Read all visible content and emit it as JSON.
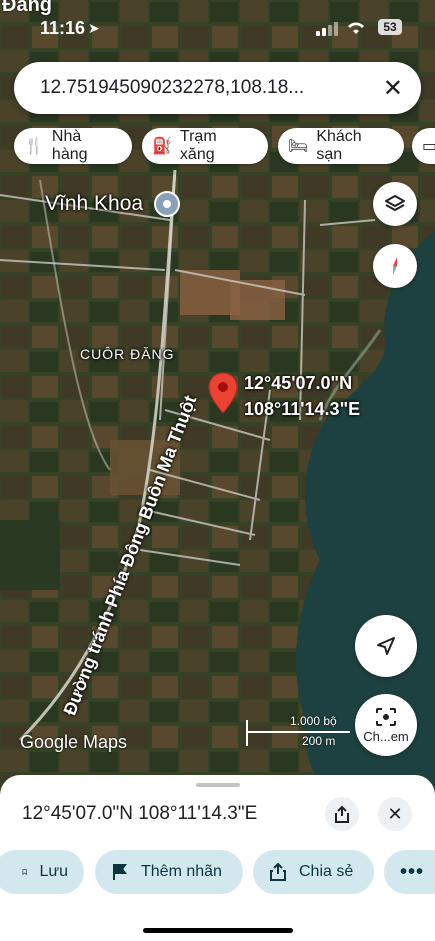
{
  "status_bar": {
    "place_partial": "Đăng",
    "time": "11:16",
    "battery": "53"
  },
  "search": {
    "query": "12.751945090232278,108.18..."
  },
  "chips": [
    {
      "label": "Nhà hàng",
      "icon": "fork-knife-icon"
    },
    {
      "label": "Trạm xăng",
      "icon": "gas-station-icon"
    },
    {
      "label": "Khách sạn",
      "icon": "bed-icon"
    }
  ],
  "map": {
    "place_vinh_khoa": "Vĩnh Khoa",
    "place_cuon_dang": "CUÔR ĐĂNG",
    "road_label": "Đường tránh Phía Đông Buôn Ma Thuột",
    "pin_lat": "12°45'07.0\"N",
    "pin_lon": "108°11'14.3\"E",
    "logo": "Google Maps",
    "scale_top": "1.000 bộ",
    "scale_bottom": "200 m",
    "camera_label": "Ch...em"
  },
  "sheet": {
    "coords": "12°45'07.0\"N 108°11'14.3\"E"
  },
  "actions": [
    {
      "label": "Lưu",
      "icon": "bookmark-icon"
    },
    {
      "label": "Thêm nhãn",
      "icon": "flag-icon"
    },
    {
      "label": "Chia sẻ",
      "icon": "share-icon"
    }
  ],
  "colors": {
    "pin": "#ea4335",
    "action_bg": "#d3e8ee",
    "water": "#1d4140"
  }
}
